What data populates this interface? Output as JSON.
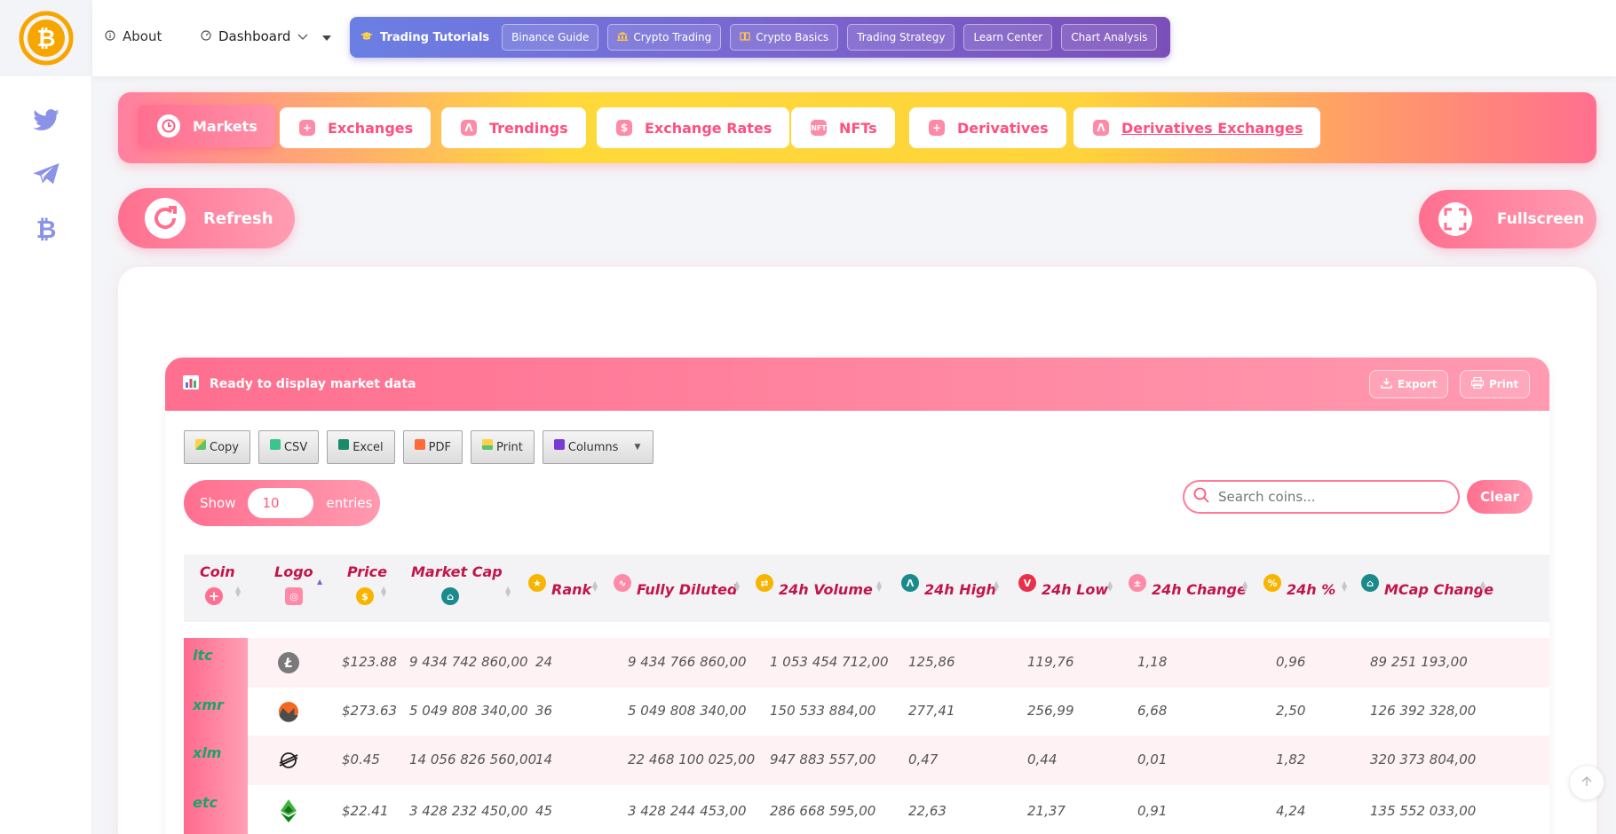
{
  "topbar": {
    "about_label": "About",
    "dashboard_label": "Dashboard"
  },
  "tutorials": {
    "title": "Trading Tutorials",
    "links": [
      "Binance Guide",
      "Crypto Trading",
      "Crypto Basics",
      "Trading Strategy",
      "Learn Center",
      "Chart Analysis"
    ]
  },
  "tabs": [
    "Markets",
    "Exchanges",
    "Trendings",
    "Exchange Rates",
    "NFTs",
    "Derivatives",
    "Derivatives Exchanges"
  ],
  "actions": {
    "refresh_label": "Refresh",
    "fullscreen_label": "Fullscreen"
  },
  "table_card": {
    "status_text": "Ready to display market data",
    "export_label": "Export",
    "print_label": "Print"
  },
  "dt_buttons": [
    "Copy",
    "CSV",
    "Excel",
    "PDF",
    "Print",
    "Columns"
  ],
  "entries": {
    "show_label": "Show",
    "value": "10",
    "suffix_label": "entries"
  },
  "search": {
    "placeholder": "Search coins...",
    "clear_label": "Clear"
  },
  "columns": [
    "Coin",
    "Logo",
    "Price",
    "Market Cap",
    "Rank",
    "Fully Diluted",
    "24h Volume",
    "24h High",
    "24h Low",
    "24h Change",
    "24h %",
    "MCap Change"
  ],
  "rows": [
    {
      "coin": "ltc",
      "price": "$123.88",
      "market_cap": "9 434 742 860,00",
      "rank": "24",
      "fully_diluted": "9 434 766 860,00",
      "volume": "1 053 454 712,00",
      "high": "125,86",
      "low": "119,76",
      "change": "1,18",
      "pct": "0,96",
      "mcap_change": "89 251 193,00"
    },
    {
      "coin": "xmr",
      "price": "$273.63",
      "market_cap": "5 049 808 340,00",
      "rank": "36",
      "fully_diluted": "5 049 808 340,00",
      "volume": "150 533 884,00",
      "high": "277,41",
      "low": "256,99",
      "change": "6,68",
      "pct": "2,50",
      "mcap_change": "126 392 328,00"
    },
    {
      "coin": "xlm",
      "price": "$0.45",
      "market_cap": "14 056 826 560,00",
      "rank": "14",
      "fully_diluted": "22 468 100 025,00",
      "volume": "947 883 557,00",
      "high": "0,47",
      "low": "0,44",
      "change": "0,01",
      "pct": "1,82",
      "mcap_change": "320 373 804,00"
    },
    {
      "coin": "etc",
      "price": "$22.41",
      "market_cap": "3 428 232 450,00",
      "rank": "45",
      "fully_diluted": "3 428 244 453,00",
      "volume": "286 668 595,00",
      "high": "22,63",
      "low": "21,37",
      "change": "0,91",
      "pct": "4,24",
      "mcap_change": "135 552 033,00"
    }
  ]
}
